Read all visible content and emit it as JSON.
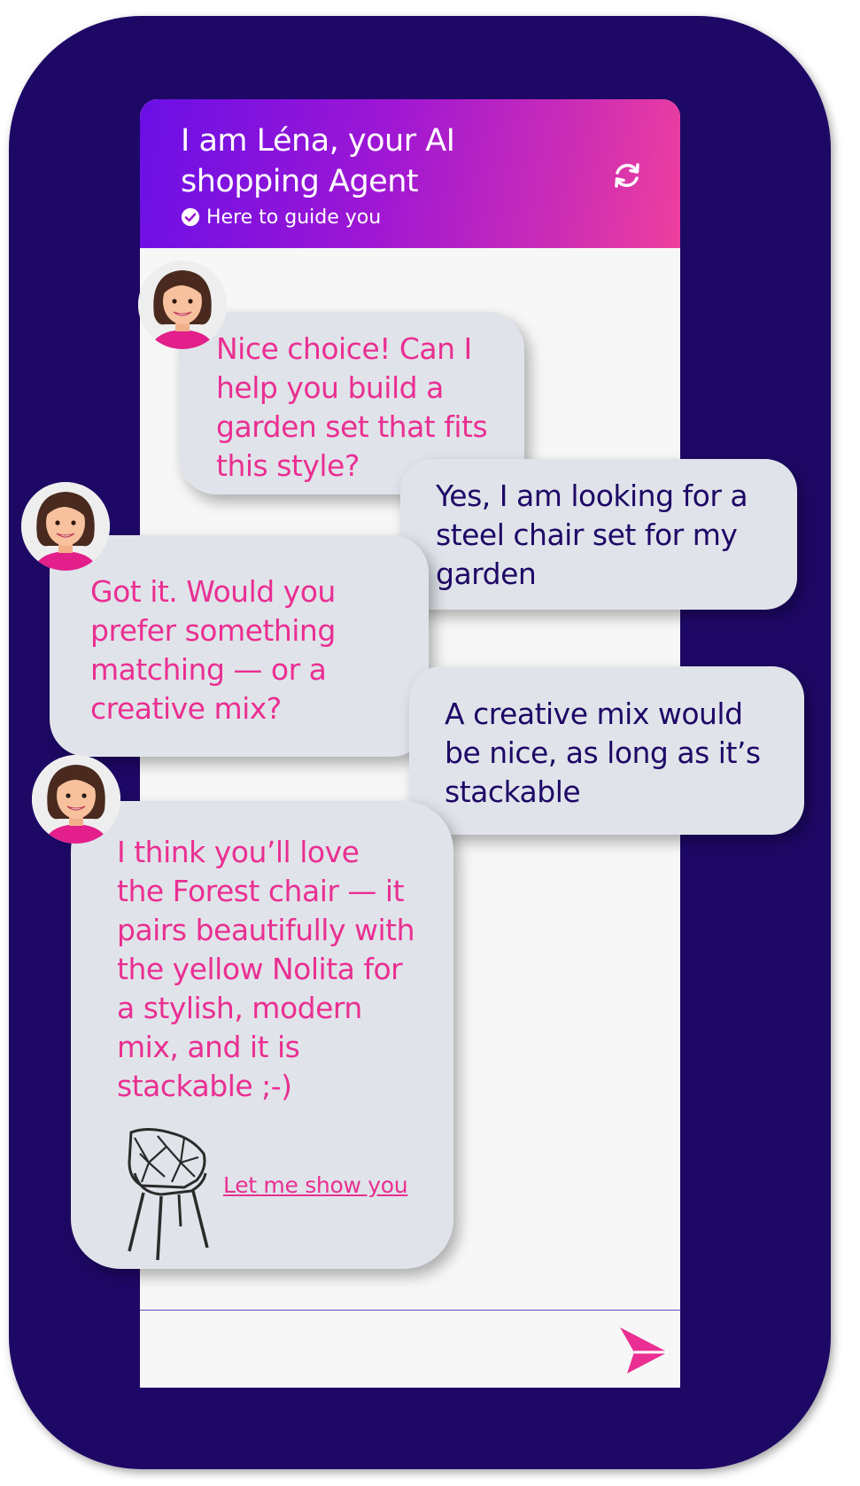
{
  "header": {
    "title": "I am Léna, your AI shopping Agent",
    "subtitle": "Here to guide you",
    "icons": {
      "status": "check-circle-icon",
      "refresh": "refresh-icon"
    }
  },
  "messages": [
    {
      "sender": "agent",
      "text": "Nice choice! Can I\nhelp you build a\ngarden set that fits\nthis style?"
    },
    {
      "sender": "user",
      "text": "Yes, I am looking for a\nsteel chair set for my\ngarden"
    },
    {
      "sender": "agent",
      "text": "Got it. Would you\nprefer something\nmatching — or a\ncreative mix?"
    },
    {
      "sender": "user",
      "text": "A creative mix would\nbe nice, as long as it’s\nstackable"
    },
    {
      "sender": "agent",
      "text": "I think you’ll love\nthe Forest chair — it\npairs beautifully with\nthe yellow Nolita for\na stylish, modern\nmix, and it is\nstackable ;-)",
      "link": "Let me show you",
      "product_image": "black-wire-chair"
    }
  ],
  "input": {
    "placeholder": ""
  },
  "colors": {
    "frame": "#1e0866",
    "header_gradient": [
      "#6a0fe6",
      "#ef3f9e"
    ],
    "agent_text": "#ea2f92",
    "user_text": "#1e0866",
    "bubble_bg": "#e0e4ea"
  }
}
